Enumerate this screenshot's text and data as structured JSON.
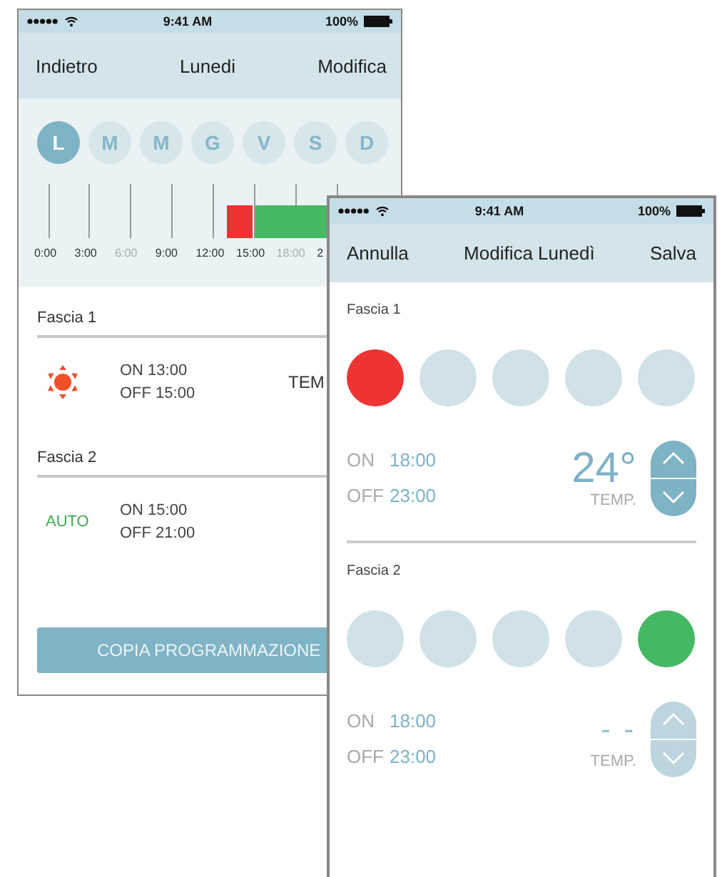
{
  "left_screen": {
    "status_bar": {
      "time": "9:41 AM",
      "battery": "100%"
    },
    "nav": {
      "back": "Indietro",
      "title": "Lunedi",
      "edit": "Modifica"
    },
    "days": [
      {
        "label": "L",
        "selected": true
      },
      {
        "label": "M",
        "selected": false
      },
      {
        "label": "M",
        "selected": false
      },
      {
        "label": "G",
        "selected": false
      },
      {
        "label": "V",
        "selected": false
      },
      {
        "label": "S",
        "selected": false
      },
      {
        "label": "D",
        "selected": false
      }
    ],
    "timeline": {
      "segments": [
        {
          "color": "#ee3333"
        },
        {
          "color": "#45b864"
        }
      ],
      "hours": [
        {
          "label": "0:00",
          "muted": false
        },
        {
          "label": "3:00",
          "muted": false
        },
        {
          "label": "6:00",
          "muted": true
        },
        {
          "label": "9:00",
          "muted": false
        },
        {
          "label": "12:00",
          "muted": false
        },
        {
          "label": "15:00",
          "muted": false
        },
        {
          "label": "18:00",
          "muted": true
        },
        {
          "label": "2",
          "muted": false
        }
      ]
    },
    "fasce": [
      {
        "title": "Fascia 1",
        "mode": {
          "kind": "sun"
        },
        "on": "ON 13:00",
        "off": "OFF 15:00",
        "temp": "TEM"
      },
      {
        "title": "Fascia 2",
        "mode": {
          "kind": "auto",
          "label": "AUTO"
        },
        "on": "ON 15:00",
        "off": "OFF 21:00"
      }
    ],
    "copy_button": "COPIA PROGRAMMAZIONE"
  },
  "right_screen": {
    "status_bar": {
      "time": "9:41 AM",
      "battery": "100%"
    },
    "nav": {
      "cancel": "Annulla",
      "title": "Modifica Lunedì",
      "save": "Salva"
    },
    "fasce": [
      {
        "title": "Fascia 1",
        "modes": [
          {
            "selected": true,
            "color": "#ee3333"
          },
          {
            "selected": false
          },
          {
            "selected": false
          },
          {
            "selected": false
          },
          {
            "selected": false
          }
        ],
        "on_label": "ON",
        "on": "18:00",
        "off_label": "OFF",
        "off": "23:00",
        "temp": "24°",
        "temp_label": "TEMP.",
        "disabled": false
      },
      {
        "title": "Fascia 2",
        "modes": [
          {
            "selected": false
          },
          {
            "selected": false
          },
          {
            "selected": false
          },
          {
            "selected": false
          },
          {
            "selected": true,
            "color": "#45b864"
          }
        ],
        "on_label": "ON",
        "on": "18:00",
        "off_label": "OFF",
        "off": "23:00",
        "temp": "- -",
        "temp_label": "TEMP.",
        "disabled": true
      }
    ]
  }
}
